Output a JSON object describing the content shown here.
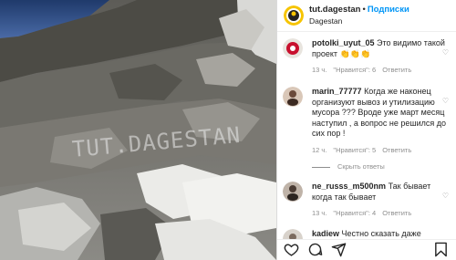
{
  "post": {
    "watermark": "TUT.DAGESTAN"
  },
  "header": {
    "username": "tut.dagestan",
    "separator": "•",
    "follow_label": "Подписки",
    "location": "Dagestan"
  },
  "comments": [
    {
      "username": "potolki_uyut_05",
      "text": "Это видимо такой проект 👏👏👏",
      "age": "13 ч.",
      "likes": "\"Нравится\": 6",
      "reply": "Ответить"
    },
    {
      "username": "marin_77777",
      "text": "Когда же наконец организуют вывоз и утилизацию мусора ??? Вроде уже март месяц наступил , а вопрос не решился до сих пор !",
      "age": "12 ч.",
      "likes": "\"Нравится\": 5",
      "reply": "Ответить"
    },
    {
      "username": "ne_russs_m500nm",
      "text": "Так бывает когда так бывает",
      "age": "13 ч.",
      "likes": "\"Нравится\": 4",
      "reply": "Ответить"
    },
    {
      "username": "kadiew",
      "text": "Честно сказать даже",
      "age": "",
      "likes": "",
      "reply": ""
    }
  ],
  "hide_replies_label": "Скрыть ответы",
  "icons": [
    "heart-icon",
    "comment-icon",
    "share-icon",
    "bookmark-icon"
  ],
  "colors": {
    "link": "#0095f6",
    "muted": "#8e8e8e",
    "text": "#262626"
  }
}
